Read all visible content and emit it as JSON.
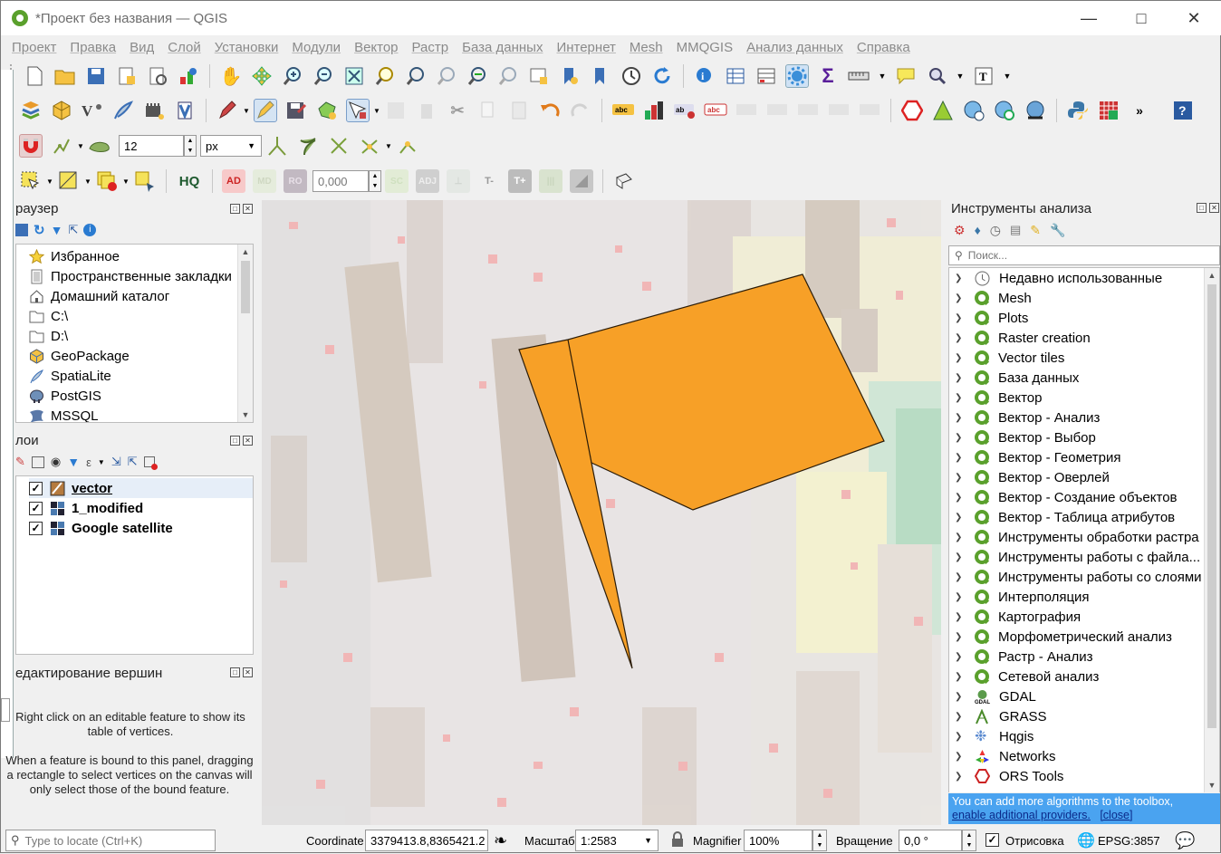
{
  "window": {
    "title": "*Проект без названия — QGIS"
  },
  "menu": [
    "Проект",
    "Правка",
    "Вид",
    "Слой",
    "Установки",
    "Модули",
    "Вектор",
    "Растр",
    "База данных",
    "Интернет",
    "Mesh",
    "MMQGIS",
    "Анализ данных",
    "Справка"
  ],
  "snapping": {
    "tolerance": "12",
    "unit": "px"
  },
  "digitize": {
    "angle_value": "0,000",
    "ad_label": "AD",
    "hq_label": "HQ"
  },
  "browser": {
    "title": "раузер",
    "items": [
      "Избранное",
      "Пространственные закладки",
      "Домашний каталог",
      "C:\\",
      "D:\\",
      "GeoPackage",
      "SpatiaLite",
      "PostGIS",
      "MSSQL"
    ]
  },
  "layers": {
    "title": "лои",
    "items": [
      {
        "name": "vector",
        "checked": true
      },
      {
        "name": "1_modified",
        "checked": true
      },
      {
        "name": "Google satellite",
        "checked": true
      }
    ]
  },
  "vertex_editor": {
    "title": "едактирование вершин",
    "text1": "Right click on an editable feature to show its table of vertices.",
    "text2": "When a feature is bound to this panel, dragging a rectangle to select vertices on the canvas will only select those of the bound feature."
  },
  "processing": {
    "title": "Инструменты анализа",
    "search_placeholder": "Поиск...",
    "items": [
      "Недавно использованные",
      "Mesh",
      "Plots",
      "Raster creation",
      "Vector tiles",
      "База данных",
      "Вектор",
      "Вектор - Анализ",
      "Вектор - Выбор",
      "Вектор - Геометрия",
      "Вектор - Оверлей",
      "Вектор - Создание объектов",
      "Вектор - Таблица атрибутов",
      "Инструменты обработки растра",
      "Инструменты работы с файла...",
      "Инструменты работы со слоями",
      "Интерполяция",
      "Картография",
      "Морфометрический анализ",
      "Растр - Анализ",
      "Сетевой анализ",
      "GDAL",
      "GRASS",
      "Hqgis",
      "Networks",
      "ORS Tools"
    ],
    "notice": "You can add more algorithms to the toolbox,",
    "notice_link": "enable additional providers.",
    "notice_close": "[close]"
  },
  "status": {
    "locate_placeholder": "Type to locate (Ctrl+K)",
    "coordinate_label": "Coordinate",
    "coordinate": "3379413.8,8365421.2",
    "scale_label": "Масштаб",
    "scale": "1:2583",
    "magnifier_label": "Magnifier",
    "magnifier": "100%",
    "rotation_label": "Вращение",
    "rotation": "0,0 °",
    "render_label": "Отрисовка",
    "crs": "EPSG:3857"
  },
  "colors": {
    "polygon_fill": "#f7a027",
    "accent_blue": "#4aa3f0"
  }
}
